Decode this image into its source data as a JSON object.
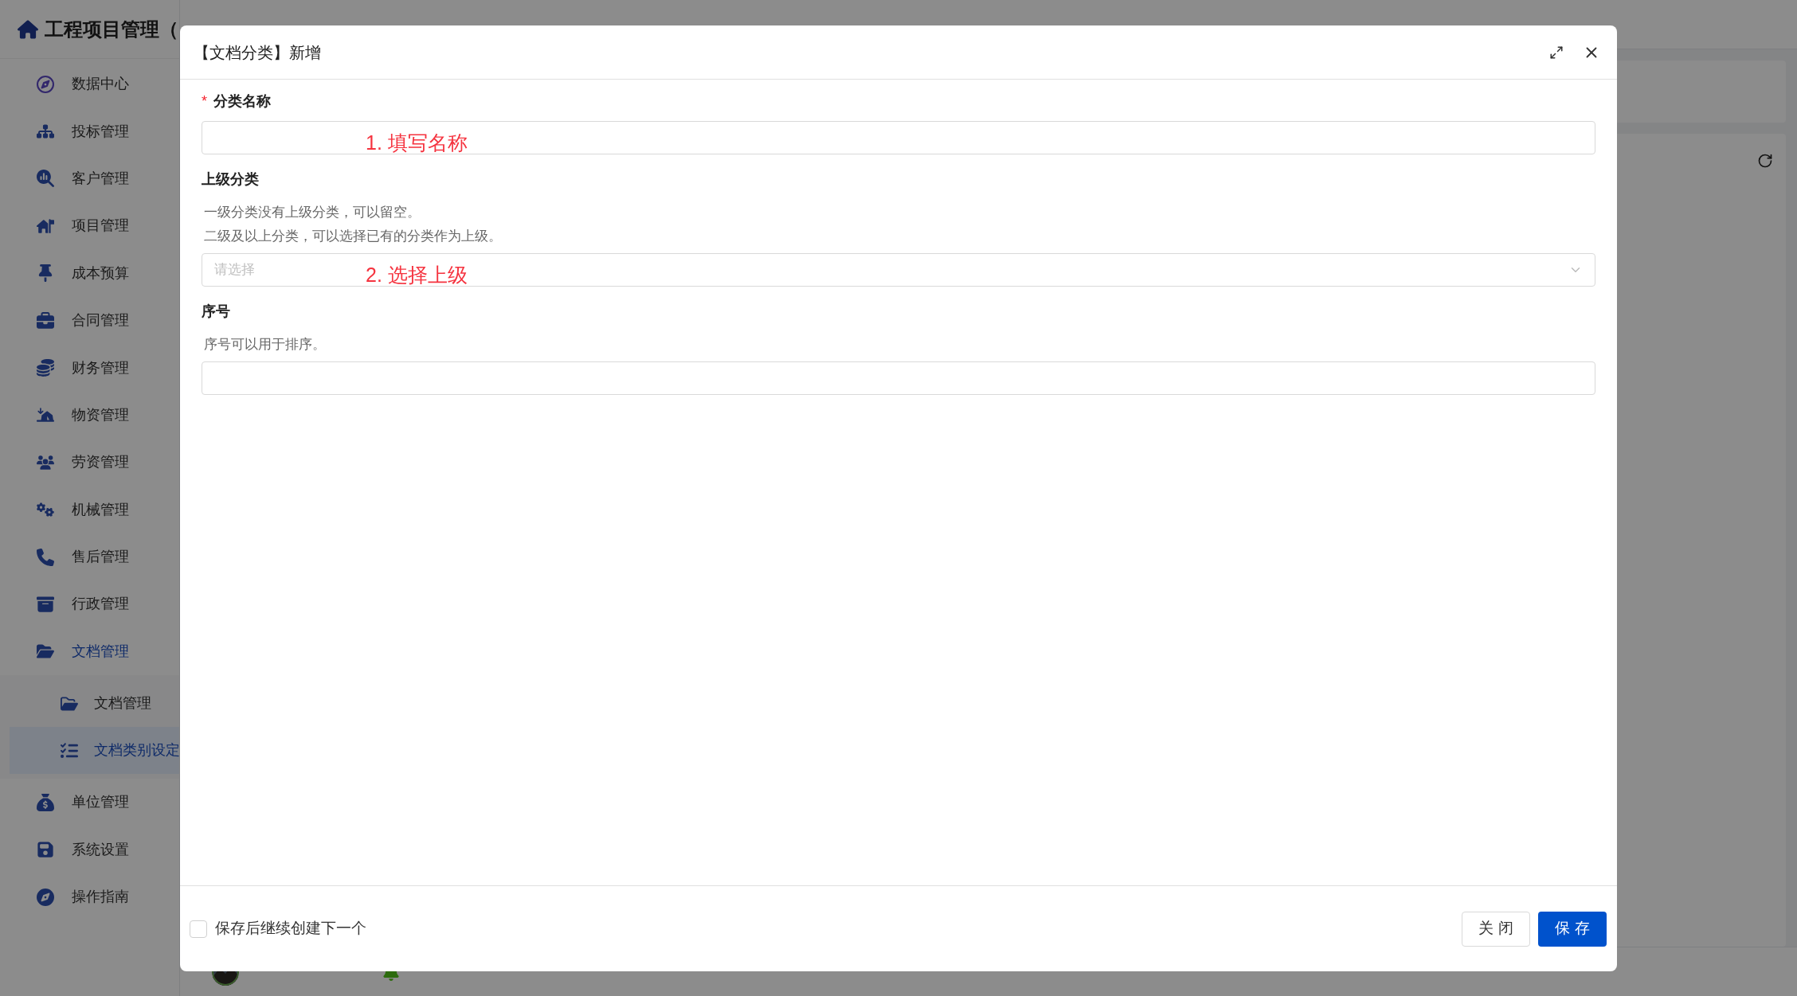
{
  "app": {
    "title": "工程项目管理（",
    "sidebar": {
      "items": [
        {
          "label": "数据中心",
          "selected": false
        },
        {
          "label": "投标管理",
          "selected": false
        },
        {
          "label": "客户管理",
          "selected": false
        },
        {
          "label": "项目管理",
          "selected": false
        },
        {
          "label": "成本预算",
          "selected": false
        },
        {
          "label": "合同管理",
          "selected": false
        },
        {
          "label": "财务管理",
          "selected": false
        },
        {
          "label": "物资管理",
          "selected": false
        },
        {
          "label": "劳资管理",
          "selected": false
        },
        {
          "label": "机械管理",
          "selected": false
        },
        {
          "label": "售后管理",
          "selected": false
        },
        {
          "label": "行政管理",
          "selected": false
        },
        {
          "label": "文档管理",
          "selected": true,
          "children": [
            {
              "label": "文档管理",
              "selected": false
            },
            {
              "label": "文档类别设定",
              "selected": true
            }
          ]
        },
        {
          "label": "单位管理",
          "selected": false
        },
        {
          "label": "系统设置",
          "selected": false
        },
        {
          "label": "操作指南",
          "selected": false
        }
      ]
    }
  },
  "dialog": {
    "title": "【文档分类】新增",
    "fields": [
      {
        "kind": "text",
        "label": "分类名称",
        "required_mark": "*",
        "annotation": "1. 填写名称"
      },
      {
        "kind": "select",
        "label": "上级分类",
        "hints": [
          "一级分类没有上级分类，可以留空。",
          "二级及以上分类，可以选择已有的分类作为上级。"
        ],
        "placeholder": "请选择",
        "annotation": "2. 选择上级"
      },
      {
        "kind": "text",
        "label": "序号",
        "hints": [
          "序号可以用于排序。"
        ]
      }
    ],
    "continue_checkbox": {
      "label": "保存后继续创建下一个",
      "checked": false
    },
    "buttons": [
      {
        "label": "关 闭",
        "kind": "secondary"
      },
      {
        "label": "保 存",
        "kind": "primary"
      }
    ]
  }
}
